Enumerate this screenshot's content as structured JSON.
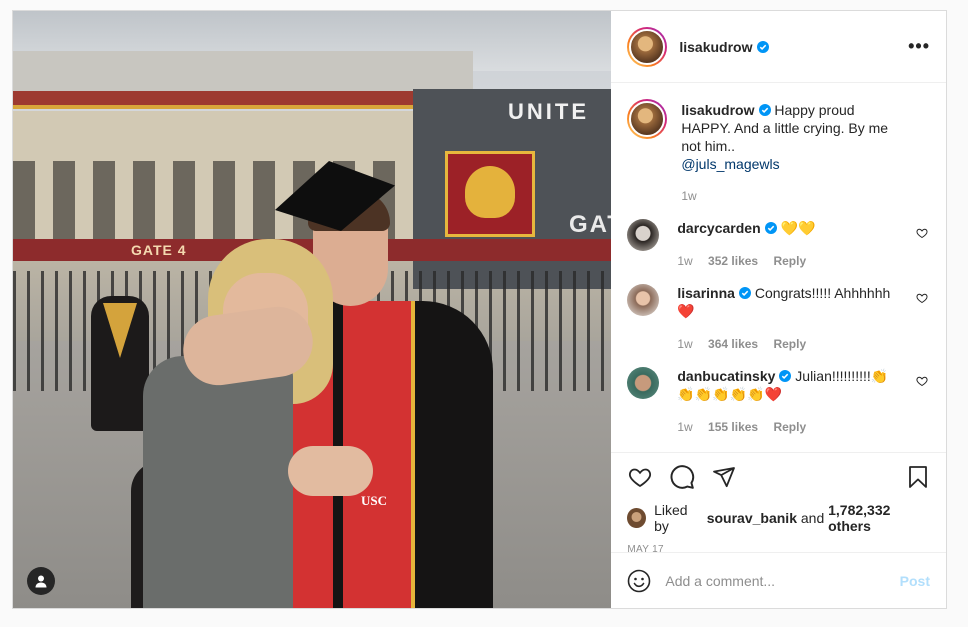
{
  "colors": {
    "border": "#dbdbdb",
    "text": "#262626",
    "muted": "#8e8e8e",
    "link": "#00376b",
    "verified": "#0095f6",
    "heart_red": "#ed4956",
    "post_disabled": "#b2dffc"
  },
  "post": {
    "author": "lisakudrow",
    "photo_alt_badges": {
      "gate_text": "GATE 4",
      "stadium_text": "UNITE",
      "gat_text": "GAT",
      "usc_text": "USC"
    }
  },
  "header": {
    "username": "lisakudrow",
    "more_label": "•••"
  },
  "caption": {
    "username": "lisakudrow",
    "text": "Happy proud HAPPY. And a little crying. By me not him..",
    "mention": "@juls_magewls",
    "time": "1w"
  },
  "comments": [
    {
      "username": "darcycarden",
      "text": "💛💛",
      "time": "1w",
      "likes": "352 likes",
      "reply": "Reply"
    },
    {
      "username": "lisarinna",
      "text": "Congrats!!!!! Ahhhhhh ❤️",
      "time": "1w",
      "likes": "364 likes",
      "reply": "Reply"
    },
    {
      "username": "danbucatinsky",
      "text": "Julian!!!!!!!!!!👏👏👏👏👏👏❤️",
      "time": "1w",
      "likes": "155 likes",
      "reply": "Reply"
    }
  ],
  "likes": {
    "prefix": "Liked by",
    "user": "sourav_banik",
    "middle": "and",
    "others": "1,782,332 others"
  },
  "date": "MAY 17",
  "add_comment": {
    "placeholder": "Add a comment...",
    "post_label": "Post"
  },
  "icons": {
    "like": "heart-icon",
    "comment": "comment-icon",
    "share": "share-icon",
    "save": "bookmark-icon",
    "emoji": "emoji-icon",
    "tags": "user-tag-icon"
  }
}
